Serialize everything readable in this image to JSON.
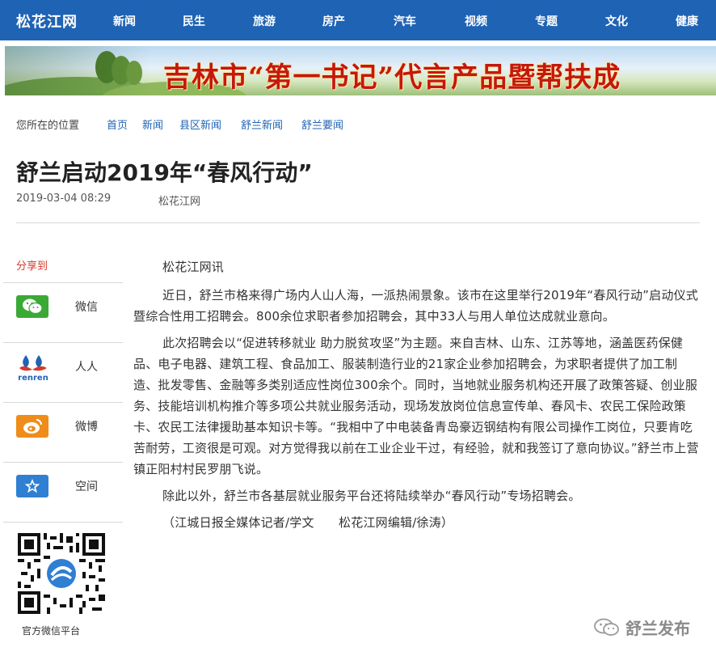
{
  "site": {
    "logo": "松花江网"
  },
  "nav": [
    "新闻",
    "民生",
    "旅游",
    "房产",
    "汽车",
    "视频",
    "专题",
    "文化",
    "健康"
  ],
  "banner": {
    "text": "吉林市“第一书记”代言产品暨帮扶成"
  },
  "breadcrumb": {
    "label": "您所在的位置",
    "items": [
      "首页",
      "新闻",
      "县区新闻",
      "舒兰新闻",
      "舒兰要闻"
    ]
  },
  "article": {
    "title": "舒兰启动2019年“春风行动”",
    "date": "2019-03-04 08:29",
    "source": "松花江网",
    "paragraphs": [
      "松花江网讯",
      "近日，舒兰市格来得广场内人山人海，一派热闹景象。该市在这里举行2019年“春风行动”启动仪式暨综合性用工招聘会。800余位求职者参加招聘会，其中33人与用人单位达成就业意向。",
      "此次招聘会以“促进转移就业 助力脱贫攻坚”为主题。来自吉林、山东、江苏等地，涵盖医药保健品、电子电器、建筑工程、食品加工、服装制造行业的21家企业参加招聘会，为求职者提供了加工制造、批发零售、金融等多类别适应性岗位300余个。同时，当地就业服务机构还开展了政策答疑、创业服务、技能培训机构推介等多项公共就业服务活动，现场发放岗位信息宣传单、春风卡、农民工保险政策卡、农民工法律援助基本知识卡等。“我相中了中电装备青岛豪迈钢结构有限公司操作工岗位，只要肯吃苦耐劳，工资很是可观。对方觉得我以前在工业企业干过，有经验，就和我签订了意向协议。”舒兰市上营镇正阳村村民罗朋飞说。",
      "除此以外，舒兰市各基层就业服务平台还将陆续举办“春风行动”专场招聘会。",
      "（江城日报全媒体记者/学文　　松花江网编辑/徐涛）"
    ]
  },
  "share": {
    "title": "分享到",
    "items": [
      {
        "label": "微信",
        "icon": "wechat-icon",
        "color": "#3aa935"
      },
      {
        "label": "人人",
        "icon": "renren-icon",
        "color": "#1f63b4"
      },
      {
        "label": "微博",
        "icon": "weibo-icon",
        "color": "#f08c1a"
      },
      {
        "label": "空间",
        "icon": "qzone-icon",
        "color": "#2f7fd2"
      }
    ],
    "renren_logo_text": "renren"
  },
  "qr": {
    "label": "官方微信平台"
  },
  "watermark": {
    "text": "舒兰发布"
  },
  "colors": {
    "nav_bg": "#1f63b4",
    "link": "#1f63b4",
    "share_title": "#d63a2c"
  }
}
